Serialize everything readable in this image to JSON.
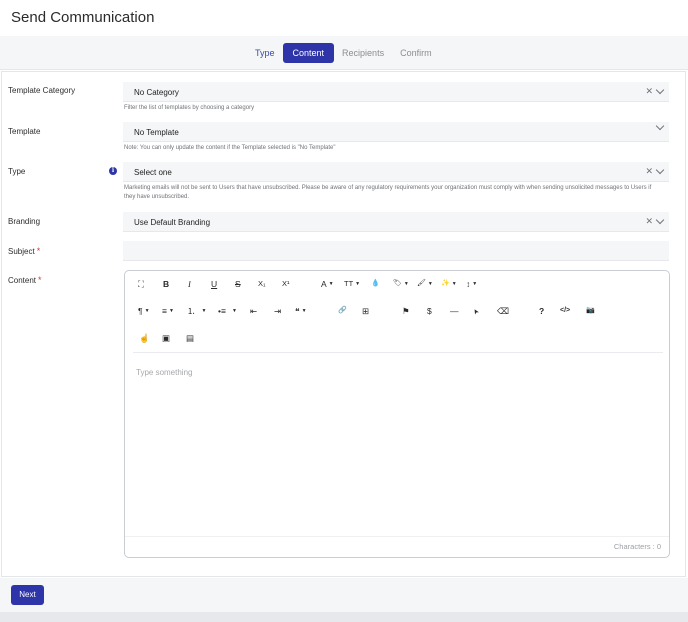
{
  "page": {
    "title": "Send Communication"
  },
  "steps": [
    {
      "label": "Type",
      "state": "done"
    },
    {
      "label": "Content",
      "state": "active"
    },
    {
      "label": "Recipients",
      "state": "upcoming"
    },
    {
      "label": "Confirm",
      "state": "upcoming"
    }
  ],
  "form": {
    "template_category": {
      "label": "Template Category",
      "value": "No Category",
      "help": "Filter the list of templates by choosing a category"
    },
    "template": {
      "label": "Template",
      "value": "No Template",
      "help": "Note: You can only update the content if the Template selected is \"No Template\""
    },
    "type": {
      "label": "Type",
      "value": "Select one",
      "help": "Marketing emails will not be sent to Users that have unsubscribed. Please be aware of any regulatory requirements your organization must comply with when sending unsolicited messages to Users if they have unsubscribed."
    },
    "branding": {
      "label": "Branding",
      "value": "Use Default Branding"
    },
    "subject": {
      "label": "Subject",
      "value": "",
      "required_mark": "*"
    },
    "content": {
      "label": "Content",
      "required_mark": "*",
      "placeholder": "Type something",
      "counter": "Characters : 0"
    }
  },
  "editor_toolbar": {
    "fullscreen": "⛶",
    "bold": "B",
    "italic": "I",
    "underline": "U",
    "strikethrough": "S",
    "subscript": "X₁",
    "superscript": "X¹",
    "font_color": "A",
    "font_size": "TT",
    "ink": "💧",
    "tag": "🏷",
    "brush": "🖌",
    "magic": "✨",
    "line_height": "↕",
    "paragraph": "¶",
    "align": "≡",
    "ordered_list": "⒈",
    "unordered_list": "•≡",
    "outdent": "⇤",
    "indent": "⇥",
    "quote": "❝",
    "link": "🔗",
    "table": "⊞",
    "flag": "⚑",
    "dollar": "$",
    "hr": "—",
    "cursor": "➤",
    "eraser": "⌫",
    "help": "?",
    "code": "</>",
    "camera": "📷",
    "hand": "☝",
    "embed": "▣",
    "file": "▤"
  },
  "footer": {
    "next_label": "Next"
  }
}
